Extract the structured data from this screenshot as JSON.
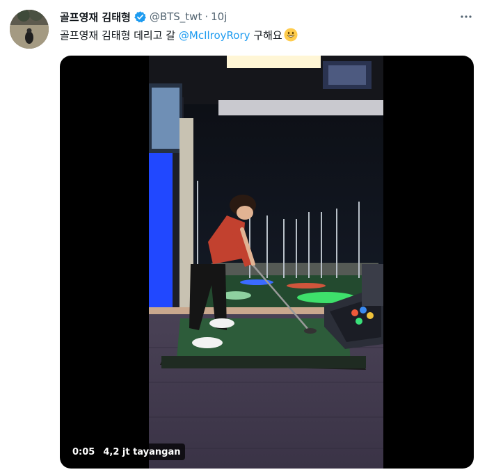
{
  "tweet": {
    "display_name": "골프영재 김태형",
    "handle": "@BTS_twt",
    "separator": "·",
    "time": "10j",
    "more_icon": "more-horizontal-icon",
    "verified_icon": "verified-badge-icon",
    "text_before": "골프영재 김태형 데리고 갈 ",
    "mention": "@McIlroyRory",
    "text_after": " 구해요",
    "emoji": "grinning-face-emoji",
    "accent_color": "#1d9bf0"
  },
  "video": {
    "elapsed": "0:05",
    "views": "4,2 jt tayangan"
  }
}
